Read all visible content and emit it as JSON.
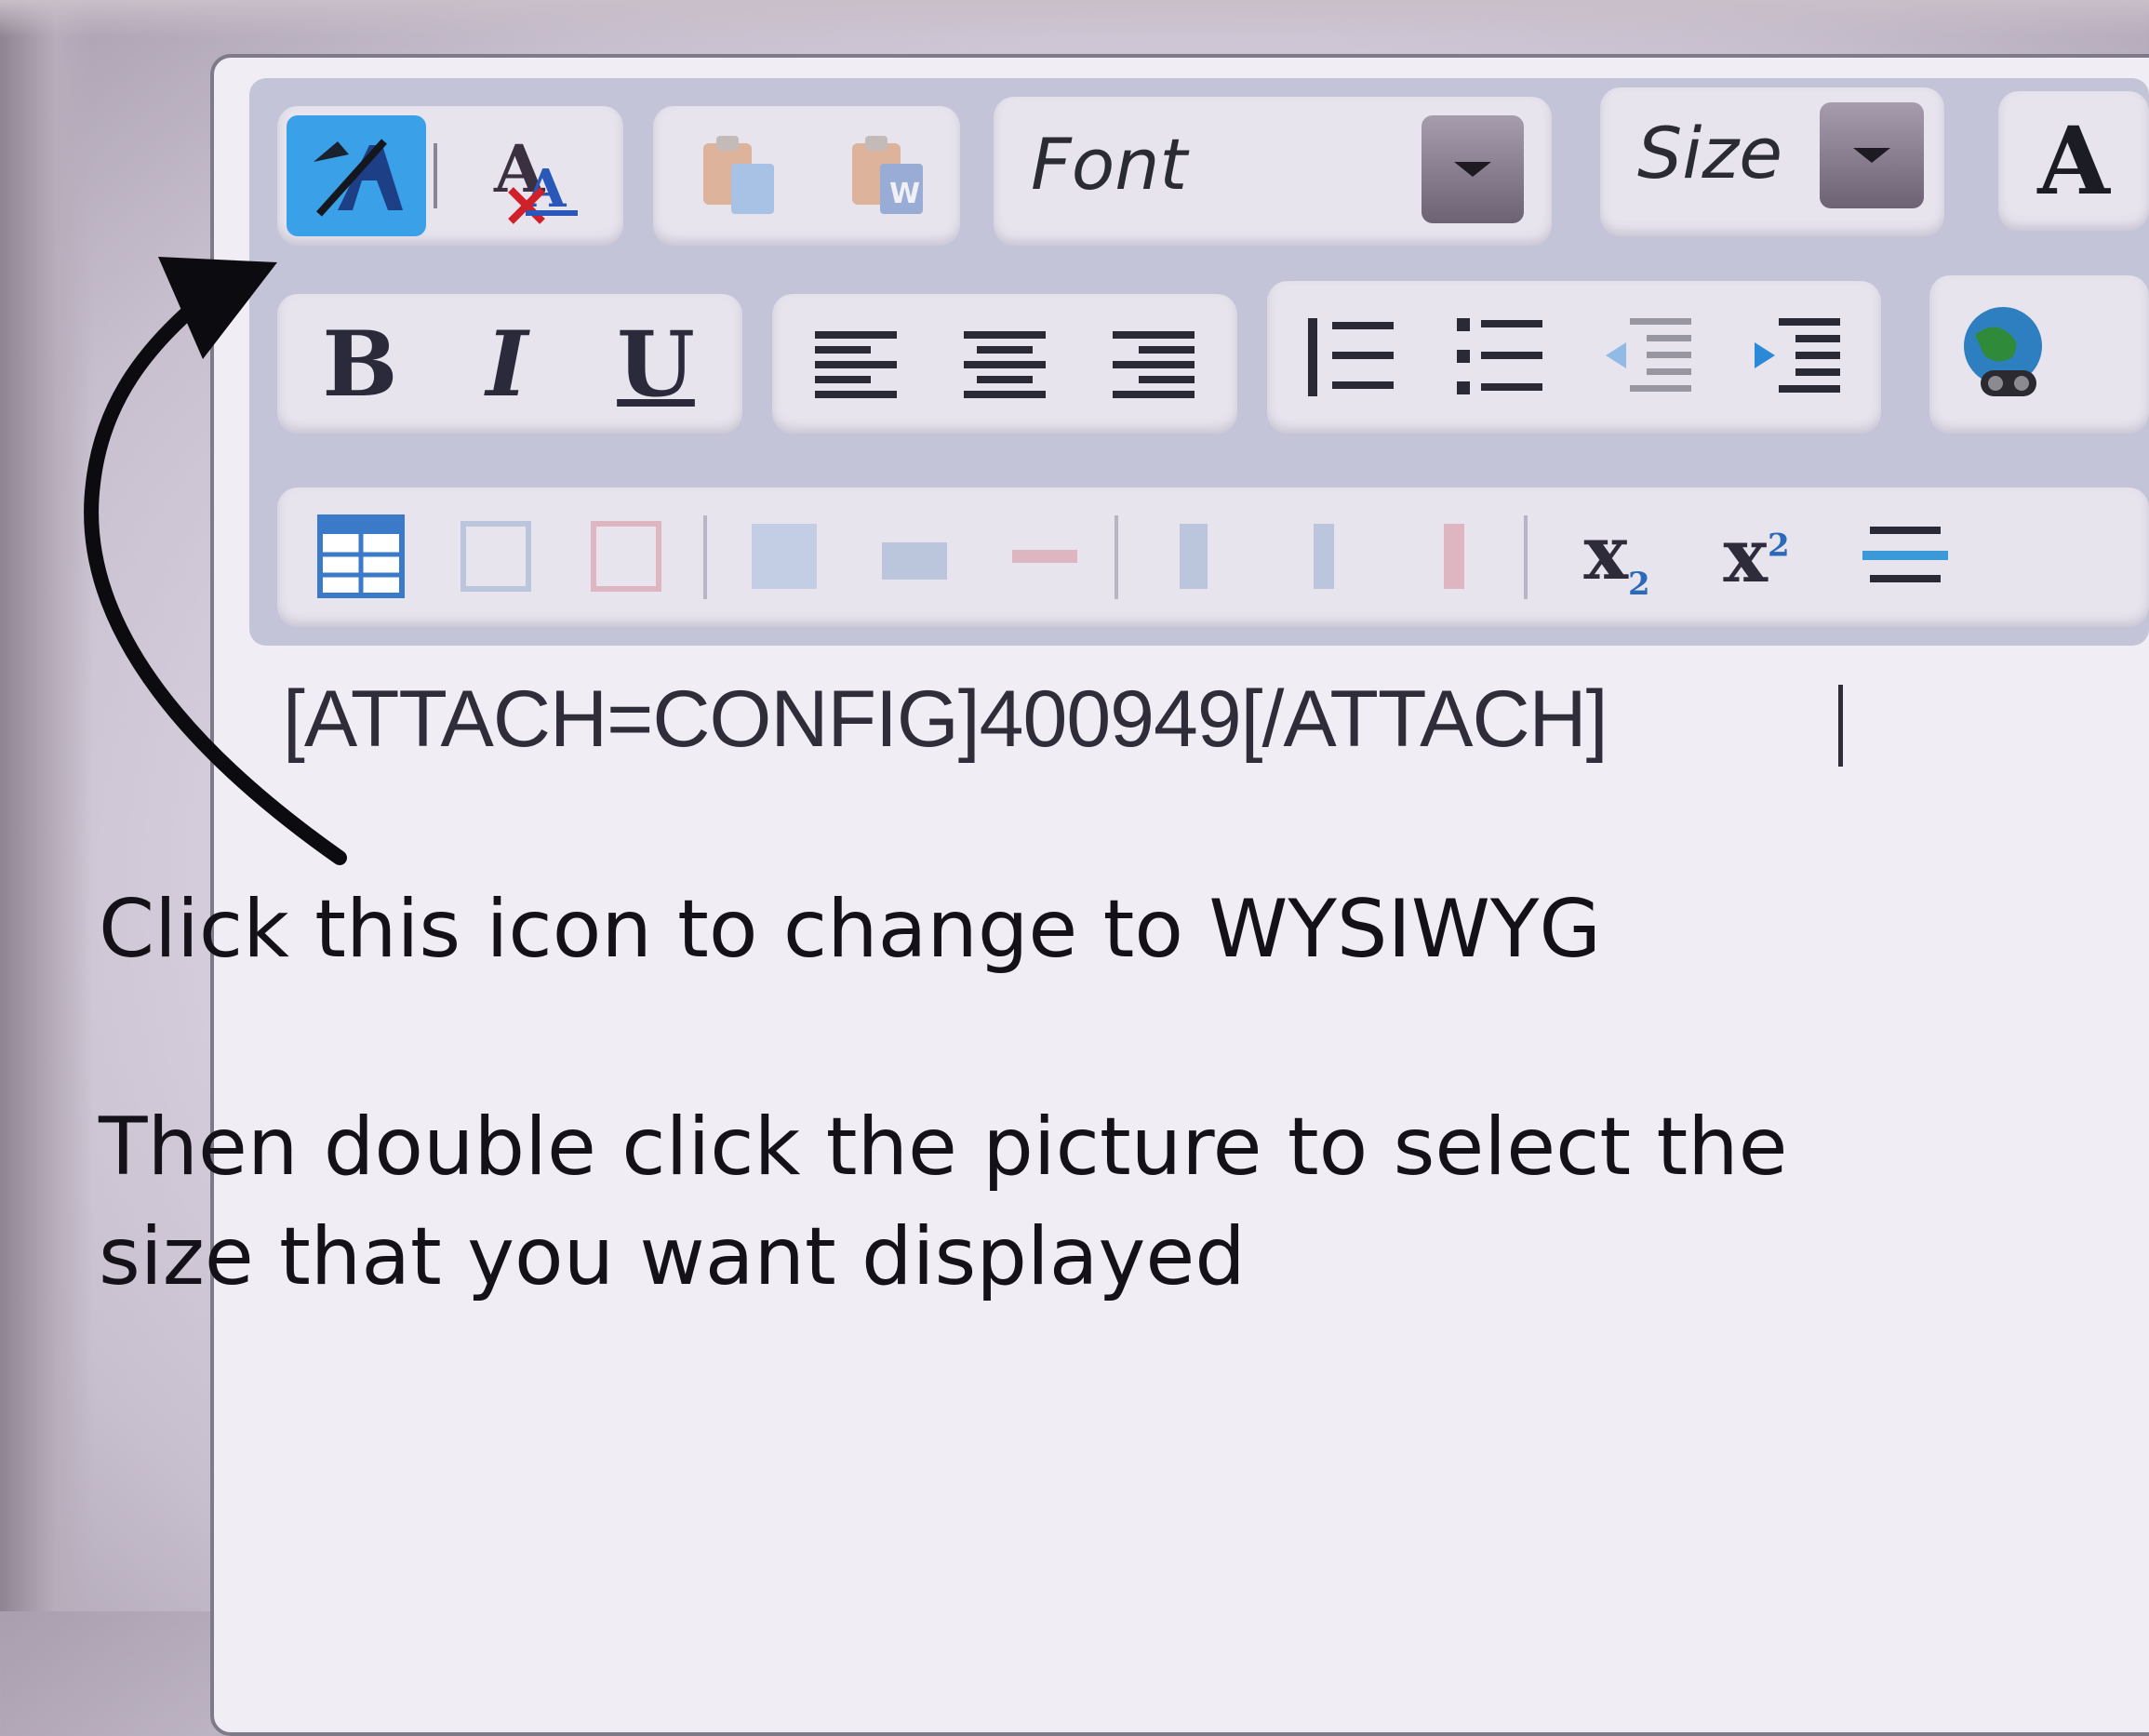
{
  "toolbar": {
    "row1": {
      "font_label": "Font",
      "size_label": "Size",
      "text_color_glyph": "A",
      "icons": [
        "switch-editor-mode-icon",
        "remove-format-icon",
        "paste-icon",
        "paste-from-word-icon",
        "font-dropdown-icon",
        "size-dropdown-icon",
        "text-color-icon"
      ]
    },
    "row2": {
      "bold_glyph": "B",
      "italic_glyph": "I",
      "underline_glyph": "U",
      "icons": [
        "align-left-icon",
        "align-center-icon",
        "align-right-icon",
        "ordered-list-icon",
        "unordered-list-icon",
        "outdent-icon",
        "indent-icon",
        "insert-link-icon"
      ]
    },
    "row3": {
      "subscript_glyph": "x",
      "subscript_mark": "2",
      "superscript_glyph": "x",
      "superscript_mark": "2",
      "icons": [
        "insert-table-icon",
        "table-row-icon",
        "table-delete-icon",
        "table-props-icon",
        "table-cell-icon",
        "table-merge-icon",
        "table-column-icon",
        "table-column-insert-icon",
        "table-column-delete-icon",
        "subscript-icon",
        "superscript-icon",
        "horizontal-rule-icon"
      ]
    }
  },
  "editor": {
    "source_text": "[ATTACH=CONFIG]400949[/ATTACH]"
  },
  "annotation": {
    "line1": "Click this icon to change to WYSIWYG",
    "line2": "Then double click the picture to select the",
    "line3": "size that you want displayed"
  },
  "colors": {
    "active_button": "#3aa0e8",
    "toolbar_bg": "#c4c4d8",
    "group_bg": "#e7e4ee",
    "text_dark": "#141218"
  }
}
